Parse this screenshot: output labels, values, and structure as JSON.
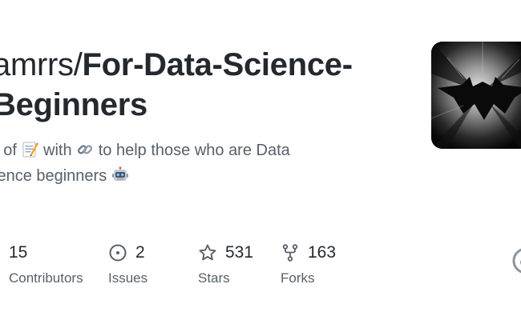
{
  "repo": {
    "owner": "amrrs/",
    "name_line1": "For-Data-Science-",
    "name_line2": "Beginners"
  },
  "description": {
    "part1": "et of ",
    "emoji1": "memo",
    "part2": " with ",
    "emoji2": "link",
    "part3": " to help those who are Data",
    "part4": "cience beginners ",
    "emoji3": "robot"
  },
  "stats": {
    "contributors": {
      "value": "15",
      "label": "Contributors"
    },
    "issues": {
      "value": "2",
      "label": "Issues",
      "icon": "issue-opened-icon"
    },
    "stars": {
      "value": "531",
      "label": "Stars",
      "icon": "star-icon"
    },
    "forks": {
      "value": "163",
      "label": "Forks",
      "icon": "repo-forked-icon"
    }
  },
  "colors": {
    "title": "#24292f",
    "muted": "#57606a",
    "background": "#ffffff"
  }
}
